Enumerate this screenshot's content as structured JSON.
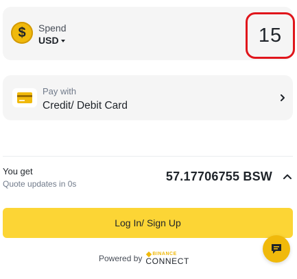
{
  "spend": {
    "label": "Spend",
    "currency": "USD",
    "amount": "15",
    "coin_symbol": "$"
  },
  "payment": {
    "label": "Pay with",
    "method": "Credit/ Debit Card"
  },
  "receive": {
    "label": "You get",
    "note": "Quote updates in 0s",
    "amount": "57.17706755 BSW"
  },
  "actions": {
    "login_label": "Log In/ Sign Up"
  },
  "footer": {
    "powered_by": "Powered by",
    "brand_top": "BINANCE",
    "brand_bottom": "CONNECT"
  },
  "icons": {
    "coin": "dollar-coin-icon",
    "card": "credit-card-icon",
    "chevron_right": "chevron-right-icon",
    "chevron_up": "chevron-up-icon",
    "chat": "chat-icon"
  },
  "colors": {
    "accent": "#fcd535",
    "brand": "#f0b90b",
    "highlight": "#e0151b",
    "card_bg": "#f5f5f5"
  }
}
